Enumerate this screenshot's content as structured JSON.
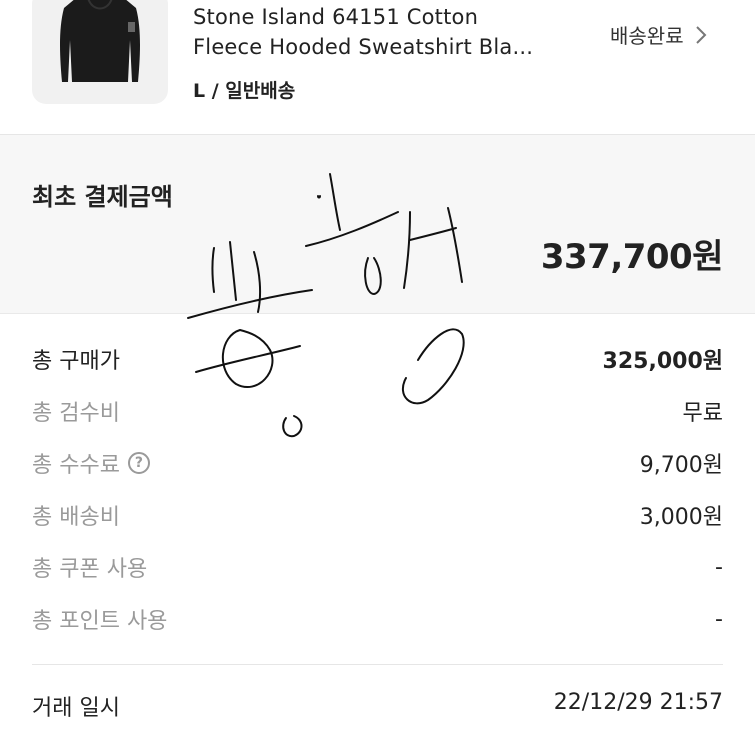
{
  "product": {
    "name_line1": "Stone Island 64151 Cotton",
    "name_line2": "Fleece Hooded Sweatshirt Bla...",
    "option": "L / 일반배송",
    "status": "배송완료"
  },
  "payment": {
    "initial_label": "최초 결제금액",
    "initial_amount": "337,700원"
  },
  "breakdown": [
    {
      "label": "총 구매가",
      "value": "325,000원"
    },
    {
      "label": "총 검수비",
      "value": "무료"
    },
    {
      "label": "총 수수료",
      "value": "9,700원"
    },
    {
      "label": "총 배송비",
      "value": "3,000원"
    },
    {
      "label": "총 쿠폰 사용",
      "value": "-"
    },
    {
      "label": "총 포인트 사용",
      "value": "-"
    }
  ],
  "transaction": {
    "label": "거래 일시",
    "value": "22/12/29 21:57"
  },
  "icons": {
    "status_chevron": "chevron-right-icon",
    "fee_help": "question-circle-icon"
  },
  "colors": {
    "text_primary": "#222222",
    "text_secondary": "#9a9a9a",
    "summary_background": "#f7f7f7"
  }
}
